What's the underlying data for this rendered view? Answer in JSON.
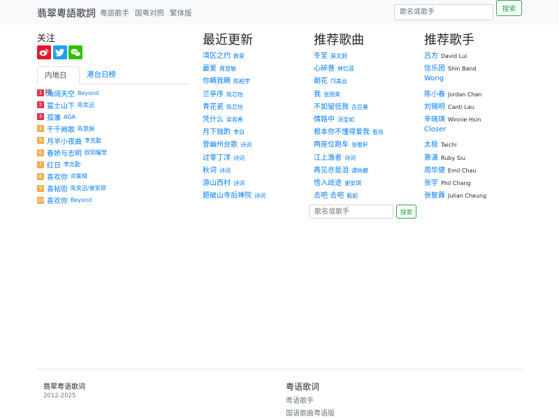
{
  "header": {
    "brand": "翡翠粵語歌詞",
    "nav": [
      "粵語歌手",
      "国粤对照",
      "繁体版"
    ],
    "search_placeholder": "歌名或歌手",
    "search_button": "搜索"
  },
  "follow": {
    "title": "关注",
    "icons": [
      "weibo-icon",
      "twitter-icon",
      "wechat-icon"
    ],
    "colors": {
      "weibo": "#e6162d",
      "twitter": "#1da1f2",
      "wechat": "#2dc100"
    }
  },
  "tabs": [
    "内地日榜",
    "港台日榜"
  ],
  "chart": [
    {
      "rank": "1",
      "song": "海阔天空",
      "artist": "Beyond",
      "hot": true
    },
    {
      "rank": "2",
      "song": "富士山下",
      "artist": "陈奕迅",
      "hot": true
    },
    {
      "rank": "3",
      "song": "孤雏",
      "artist": "AGA",
      "hot": true
    },
    {
      "rank": "4",
      "song": "千千阙歌",
      "artist": "陈慧娴",
      "hot": false
    },
    {
      "rank": "5",
      "song": "月半小夜曲",
      "artist": "李克勤",
      "hot": false
    },
    {
      "rank": "6",
      "song": "春娇与志明",
      "artist": "欧阳耀莹",
      "hot": false
    },
    {
      "rank": "7",
      "song": "红日",
      "artist": "李克勤",
      "hot": false
    },
    {
      "rank": "8",
      "song": "喜欢你",
      "artist": "邓紫棋",
      "hot": false
    },
    {
      "rank": "9",
      "song": "喜帖街",
      "artist": "陈奕迅/谢安琪",
      "hot": false
    },
    {
      "rank": "10",
      "song": "喜欢你",
      "artist": "Beyond",
      "hot": false
    }
  ],
  "recent": {
    "title": "最近更新",
    "items": [
      {
        "song": "湾区之约",
        "artist": "群星"
      },
      {
        "song": "最爱",
        "artist": "周慧敏"
      },
      {
        "song": "你瞒我瞒",
        "artist": "陈柏宇"
      },
      {
        "song": "兰亭序",
        "artist": "陈芯怡"
      },
      {
        "song": "青花瓷",
        "artist": "陈芯怡"
      },
      {
        "song": "凭什么",
        "artist": "吴若希"
      },
      {
        "song": "月下独酌",
        "artist": "李白"
      },
      {
        "song": "登幽州台歌",
        "artist": "诗词"
      },
      {
        "song": "过零丁洋",
        "artist": "诗词"
      },
      {
        "song": "秋词",
        "artist": "诗词"
      },
      {
        "song": "游山西村",
        "artist": "诗词"
      },
      {
        "song": "题破山寺后禅院",
        "artist": "诗词"
      }
    ]
  },
  "recommended_songs": {
    "title": "推荐歌曲",
    "items": [
      {
        "song": "冬至",
        "artist": "莫文蔚"
      },
      {
        "song": "心碎巷",
        "artist": "林忆莲"
      },
      {
        "song": "朝花",
        "artist": "邝美云"
      },
      {
        "song": "我",
        "artist": "张国荣"
      },
      {
        "song": "不如留低我",
        "artist": "古巨基"
      },
      {
        "song": "情路中",
        "artist": "汤宝如"
      },
      {
        "song": "根本你不懂得爱我",
        "artist": "暂存"
      },
      {
        "song": "两座位跑车",
        "artist": "张敬轩"
      },
      {
        "song": "江上渔者",
        "artist": "诗词"
      },
      {
        "song": "再见亦是泪",
        "artist": "谭咏麟"
      },
      {
        "song": "悟入歧途",
        "artist": "谢安琪"
      },
      {
        "song": "去吧 去吧",
        "artist": "甄妮"
      }
    ],
    "search_placeholder": "歌名或歌手",
    "search_button": "搜索"
  },
  "recommended_singers": {
    "title": "推荐歌手",
    "items": [
      {
        "cn": "吕方",
        "en": "David Lui"
      },
      {
        "cn": "信乐团",
        "en": "Shin Band"
      },
      {
        "cn": "Wong",
        "en": ""
      },
      {
        "cn": "陈小春",
        "en": "Jordan Chan"
      },
      {
        "cn": "刘锡明",
        "en": "Canti Lau"
      },
      {
        "cn": "辛晓琪",
        "en": "Winnie Hsin"
      },
      {
        "cn": "Closer",
        "en": ""
      },
      {
        "cn": "太极",
        "en": "Taichi"
      },
      {
        "cn": "萧潇",
        "en": "Ruby Siu"
      },
      {
        "cn": "周华健",
        "en": "Emil Chau"
      },
      {
        "cn": "张宇",
        "en": "Phil Chang"
      },
      {
        "cn": "张智霖",
        "en": "Julian Cheung"
      }
    ]
  },
  "footer": {
    "brand": "翡翠粤语歌词",
    "years": "2012-2025",
    "heading": "粤语歌词",
    "links": [
      "粤语歌手",
      "国语歌曲粤语版"
    ]
  }
}
